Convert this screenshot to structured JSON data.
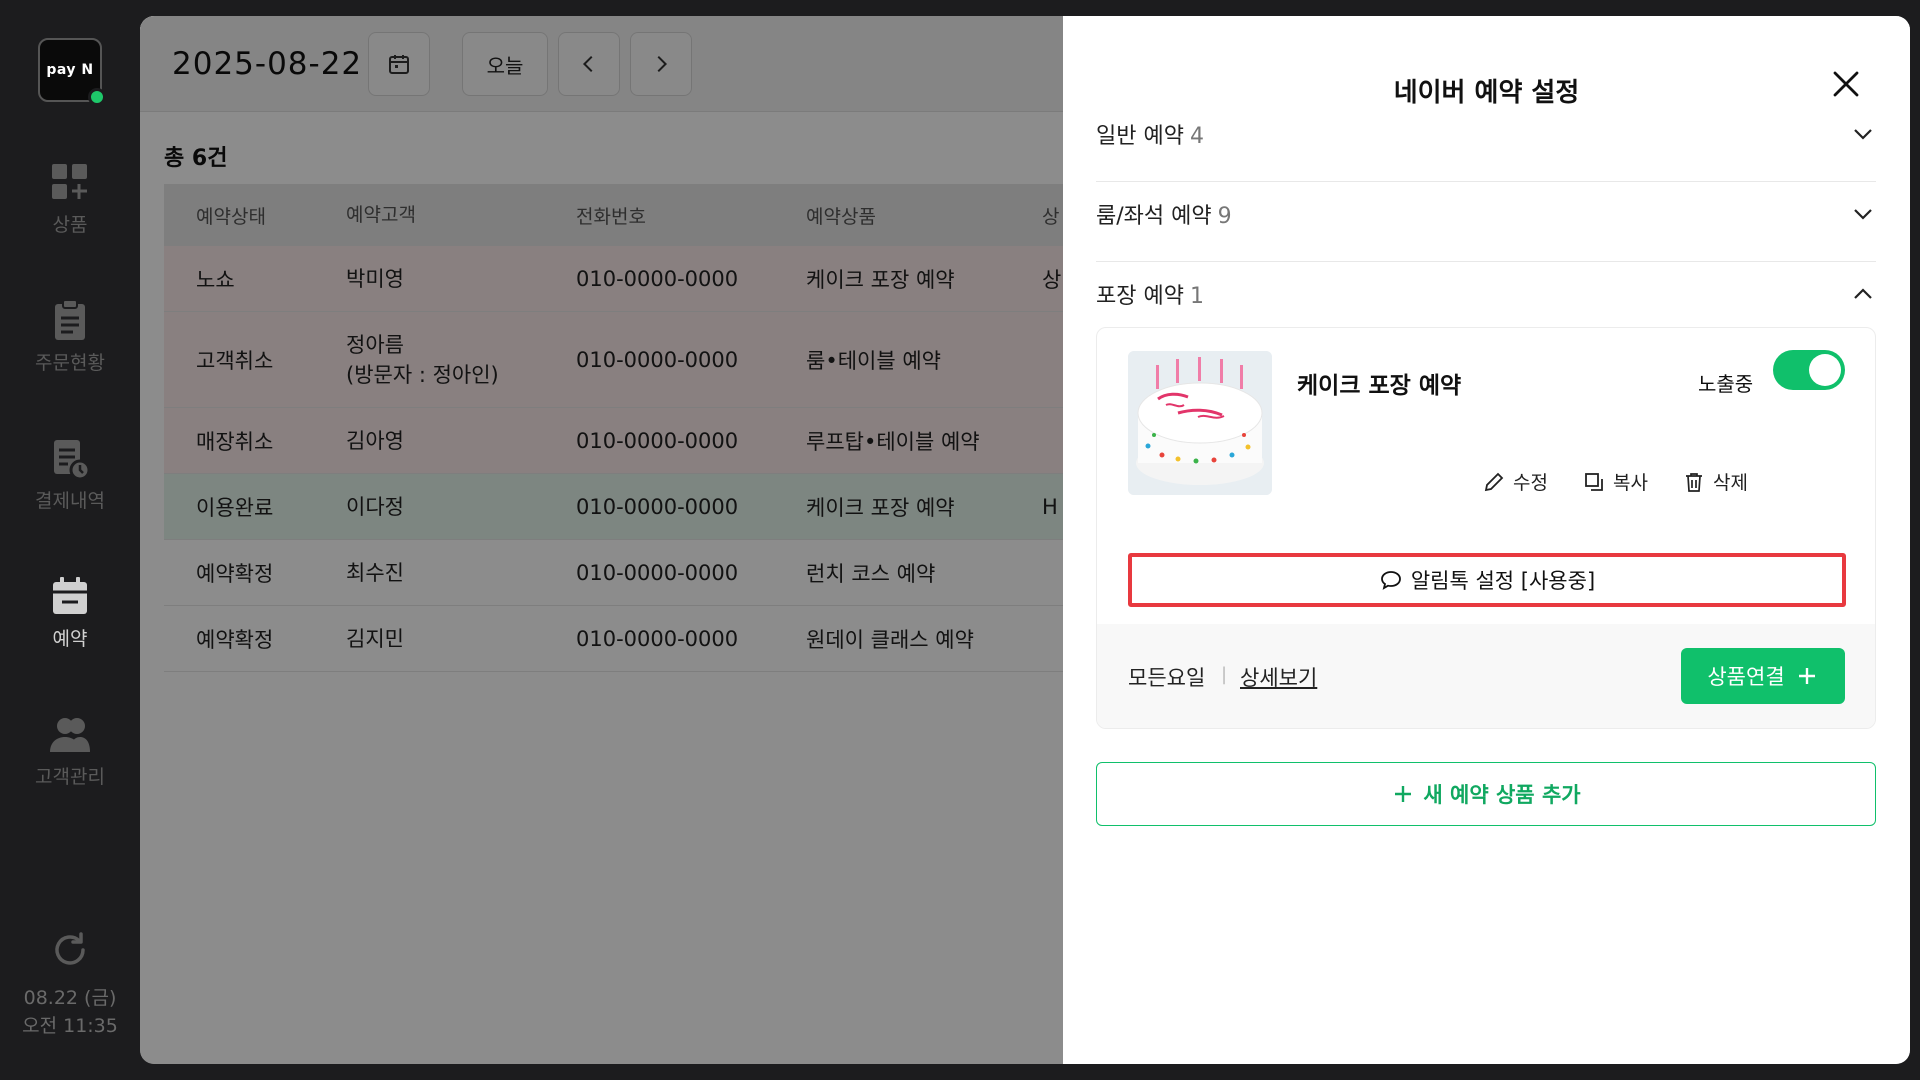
{
  "sidebar": {
    "logo_text": "pay N",
    "items": [
      {
        "label": "상품",
        "icon": "product-grid-icon"
      },
      {
        "label": "주문현황",
        "icon": "clipboard-icon"
      },
      {
        "label": "결제내역",
        "icon": "receipt-clock-icon"
      },
      {
        "label": "예약",
        "icon": "calendar-icon"
      },
      {
        "label": "고객관리",
        "icon": "users-icon"
      }
    ],
    "clock_date": "08.22 (금)",
    "clock_time": "오전 11:35"
  },
  "topbar": {
    "date": "2025-08-22",
    "today_label": "오늘"
  },
  "list": {
    "total": "총 6건",
    "headers": [
      "예약상태",
      "예약고객",
      "전화번호",
      "예약상품",
      "상"
    ],
    "rows": [
      {
        "status": "노쇼",
        "customer": "박미영",
        "sub": "",
        "phone": "010-0000-0000",
        "product": "케이크 포장 예약",
        "extra": "상"
      },
      {
        "status": "고객취소",
        "customer": "정아름",
        "sub": "(방문자 : 정아인)",
        "phone": "010-0000-0000",
        "product": "룸•테이블 예약",
        "extra": ""
      },
      {
        "status": "매장취소",
        "customer": "김아영",
        "sub": "",
        "phone": "010-0000-0000",
        "product": "루프탑•테이블 예약",
        "extra": ""
      },
      {
        "status": "이용완료",
        "customer": "이다정",
        "sub": "",
        "phone": "010-0000-0000",
        "product": "케이크 포장 예약",
        "extra": "H"
      },
      {
        "status": "예약확정",
        "customer": "최수진",
        "sub": "",
        "phone": "010-0000-0000",
        "product": "런치 코스 예약",
        "extra": ""
      },
      {
        "status": "예약확정",
        "customer": "김지민",
        "sub": "",
        "phone": "010-0000-0000",
        "product": "원데이 클래스 예약",
        "extra": ""
      }
    ]
  },
  "drawer": {
    "title": "네이버 예약 설정",
    "sections": [
      {
        "label": "일반 예약",
        "count": "4",
        "expanded": false
      },
      {
        "label": "룸/좌석 예약",
        "count": "9",
        "expanded": false
      },
      {
        "label": "포장 예약",
        "count": "1",
        "expanded": true
      }
    ],
    "product": {
      "name": "케이크 포장 예약",
      "expose_label": "노출중",
      "expose_on": true,
      "edit_label": "수정",
      "copy_label": "복사",
      "delete_label": "삭제",
      "alimtalk_label": "알림톡 설정 [사용중]",
      "days_label": "모든요일",
      "detail_label": "상세보기",
      "link_label": "상품연결"
    },
    "add_label": "새 예약 상품 추가"
  },
  "colors": {
    "accent": "#10c06b",
    "highlight": "#e8393f"
  }
}
